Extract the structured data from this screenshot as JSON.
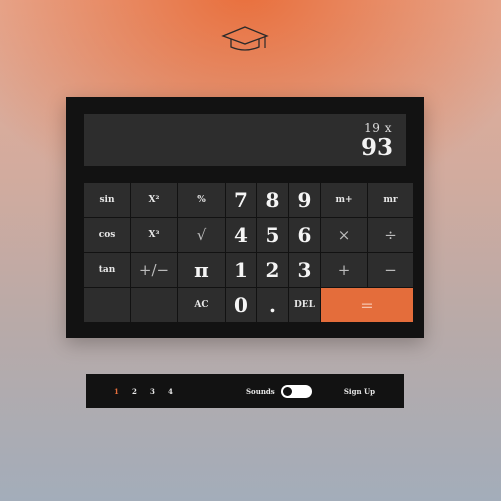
{
  "brand": {
    "icon": "graduation-cap-icon"
  },
  "display": {
    "expression": "19 x",
    "result": "93"
  },
  "keypad": {
    "rows": [
      [
        {
          "label": "sin",
          "name": "key-sin",
          "style": "fn"
        },
        {
          "label": "X²",
          "name": "key-square",
          "style": "fn"
        },
        {
          "label": "%",
          "name": "key-percent",
          "style": "fn"
        },
        {
          "label": "7",
          "name": "key-7",
          "style": "big"
        },
        {
          "label": "8",
          "name": "key-8",
          "style": "big"
        },
        {
          "label": "9",
          "name": "key-9",
          "style": "big"
        },
        {
          "label": "m+",
          "name": "key-memory-add",
          "style": "fn"
        },
        {
          "label": "mr",
          "name": "key-memory-recall",
          "style": "fn"
        }
      ],
      [
        {
          "label": "cos",
          "name": "key-cos",
          "style": "fn"
        },
        {
          "label": "X³",
          "name": "key-cube",
          "style": "fn"
        },
        {
          "label": "√",
          "name": "key-sqrt",
          "style": "op"
        },
        {
          "label": "4",
          "name": "key-4",
          "style": "big"
        },
        {
          "label": "5",
          "name": "key-5",
          "style": "big"
        },
        {
          "label": "6",
          "name": "key-6",
          "style": "big"
        },
        {
          "label": "×",
          "name": "key-multiply",
          "style": "op"
        },
        {
          "label": "÷",
          "name": "key-divide",
          "style": "op"
        }
      ],
      [
        {
          "label": "tan",
          "name": "key-tan",
          "style": "fn"
        },
        {
          "label": "+/−",
          "name": "key-negate",
          "style": "op"
        },
        {
          "label": "π",
          "name": "key-pi",
          "style": "big"
        },
        {
          "label": "1",
          "name": "key-1",
          "style": "big"
        },
        {
          "label": "2",
          "name": "key-2",
          "style": "big"
        },
        {
          "label": "3",
          "name": "key-3",
          "style": "big"
        },
        {
          "label": "+",
          "name": "key-add",
          "style": "op"
        },
        {
          "label": "−",
          "name": "key-subtract",
          "style": "op"
        }
      ],
      [
        {
          "label": "",
          "name": "key-blank-1",
          "style": "fn"
        },
        {
          "label": "",
          "name": "key-blank-2",
          "style": "fn"
        },
        {
          "label": "AC",
          "name": "key-all-clear",
          "style": "fn"
        },
        {
          "label": "0",
          "name": "key-0",
          "style": "big"
        },
        {
          "label": ".",
          "name": "key-decimal",
          "style": "big"
        },
        {
          "label": "DEL",
          "name": "key-delete",
          "style": "fn"
        },
        {
          "label": "=",
          "name": "key-equals",
          "style": "equals"
        }
      ]
    ]
  },
  "footer": {
    "pages": [
      "1",
      "2",
      "3",
      "4"
    ],
    "active_page": "1",
    "sounds_label": "Sounds",
    "sounds_on": false,
    "signup_label": "Sign Up"
  },
  "colors": {
    "accent": "#e46d3b",
    "panel": "#121212",
    "key": "#2d2d2d"
  }
}
